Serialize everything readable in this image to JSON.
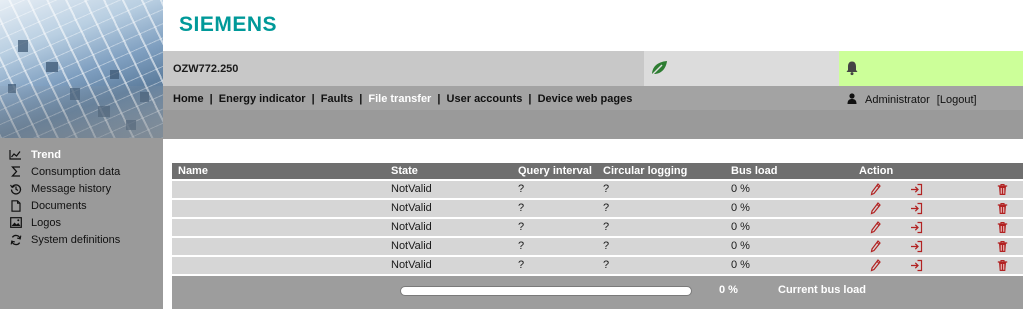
{
  "brand": {
    "logo_text": "SIEMENS",
    "color": "#009999"
  },
  "header": {
    "device_name": "OZW772.250",
    "eco_icon": "leaf-icon",
    "alarm_icon": "bell-icon",
    "eco_color": "#2e7d32",
    "alarm_bg": "#ccff99"
  },
  "nav": {
    "items": [
      {
        "label": "Home"
      },
      {
        "label": "Energy indicator"
      },
      {
        "label": "Faults"
      },
      {
        "label": "File transfer",
        "active": true
      },
      {
        "label": "User accounts"
      },
      {
        "label": "Device web pages"
      }
    ],
    "separator": "|"
  },
  "user": {
    "icon": "user-icon",
    "name": "Administrator",
    "logout_label": "[Logout]"
  },
  "sidebar": {
    "items": [
      {
        "label": "Trend",
        "icon": "trend-chart-icon",
        "active": true
      },
      {
        "label": "Consumption data",
        "icon": "sigma-icon"
      },
      {
        "label": "Message history",
        "icon": "history-icon"
      },
      {
        "label": "Documents",
        "icon": "document-icon"
      },
      {
        "label": "Logos",
        "icon": "image-icon"
      },
      {
        "label": "System definitions",
        "icon": "refresh-icon"
      }
    ]
  },
  "table": {
    "columns": [
      "Name",
      "State",
      "Query interval",
      "Circular logging",
      "Bus load",
      "Action"
    ],
    "rows": [
      {
        "name": "",
        "state": "NotValid",
        "query_interval": "?",
        "circular_logging": "?",
        "bus_load": "0 %"
      },
      {
        "name": "",
        "state": "NotValid",
        "query_interval": "?",
        "circular_logging": "?",
        "bus_load": "0 %"
      },
      {
        "name": "",
        "state": "NotValid",
        "query_interval": "?",
        "circular_logging": "?",
        "bus_load": "0 %"
      },
      {
        "name": "",
        "state": "NotValid",
        "query_interval": "?",
        "circular_logging": "?",
        "bus_load": "0 %"
      },
      {
        "name": "",
        "state": "NotValid",
        "query_interval": "?",
        "circular_logging": "?",
        "bus_load": "0 %"
      }
    ],
    "action_icons": [
      "pencil-edit-icon",
      "export-icon",
      "trash-icon"
    ],
    "action_color": "#b22222"
  },
  "footer": {
    "bus_load_value": "0 %",
    "bus_load_fraction": 0,
    "current_bus_load_label": "Current bus load"
  }
}
